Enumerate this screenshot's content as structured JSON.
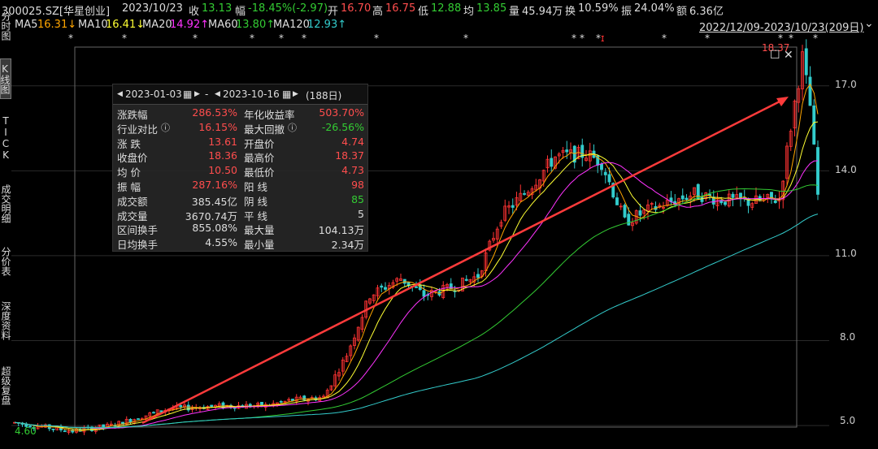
{
  "header": {
    "symbol": "300025.SZ[华星创业]",
    "date": "2023/10/23",
    "close_label": "收",
    "close": "13.13",
    "change_label": "幅",
    "change": "-18.45%(-2.97)",
    "open_label": "开",
    "open": "16.70",
    "high_label": "高",
    "high": "16.75",
    "low_label": "低",
    "low": "12.88",
    "avg_label": "均",
    "avg": "13.85",
    "vol_label": "量",
    "vol": "45.94万",
    "turnover_label": "换",
    "turnover": "10.59%",
    "amplitude_label": "振",
    "amplitude": "24.04%",
    "amount_label": "额",
    "amount": "6.36亿"
  },
  "ma": {
    "ma5_label": "MA5",
    "ma5": "16.31↓",
    "ma10_label": "MA10",
    "ma10": "16.41↓",
    "ma20_label": "MA20",
    "ma20": "14.92↑",
    "ma60_label": "MA60",
    "ma60": "13.80↑",
    "ma120_label": "MA120",
    "ma120": "12.93↑",
    "range": "2022/12/09-2023/10/23(209日)",
    "colors": {
      "ma5": "#ffa500",
      "ma10": "#ffff33",
      "ma20": "#ff33ff",
      "ma60": "#33cc33",
      "ma120": "#33cccc"
    }
  },
  "sidebar": {
    "tab1": "分时图",
    "tab2": "K线图",
    "tab3": "TICK",
    "tab4": "成交明细",
    "tab5": "分价表",
    "tab6": "深度资料",
    "tab7": "超级复盘"
  },
  "panel": {
    "start_date": "2023-01-03",
    "dash": "-",
    "end_date": "2023-10-16",
    "days": "(188日)",
    "rows": [
      {
        "l1": "涨跌幅",
        "v1": "286.53%",
        "l2": "年化收益率",
        "v2": "503.70%"
      },
      {
        "l1": "行业对比",
        "v1": "16.15%",
        "l2": "最大回撤",
        "v2": "-26.56%"
      },
      {
        "l1": "涨 跌",
        "v1": "13.61",
        "l2": "开盘价",
        "v2": "4.74"
      },
      {
        "l1": "收盘价",
        "v1": "18.36",
        "l2": "最高价",
        "v2": "18.37"
      },
      {
        "l1": "均 价",
        "v1": "10.50",
        "l2": "最低价",
        "v2": "4.73"
      },
      {
        "l1": "振 幅",
        "v1": "287.16%",
        "l2": "阳 线",
        "v2": "98"
      },
      {
        "l1": "成交额",
        "v1": "385.45亿",
        "l2": "阴 线",
        "v2": "85"
      },
      {
        "l1": "成交量",
        "v1": "3670.74万",
        "l2": "平 线",
        "v2": "5"
      },
      {
        "l1": "区间换手",
        "v1": "855.08%",
        "l2": "最大量",
        "v2": "104.13万"
      },
      {
        "l1": "日均换手",
        "v1": "4.55%",
        "l2": "最小量",
        "v2": "2.34万"
      }
    ]
  },
  "chart_data": {
    "type": "candlestick",
    "ylim": [
      4.4,
      18.6
    ],
    "yticks": [
      "17.0",
      "14.0",
      "11.0",
      "8.0",
      "5.0"
    ],
    "ytick_values": [
      17.0,
      14.0,
      11.0,
      8.0,
      5.0
    ],
    "peak_label": "18.37",
    "min_label": "4.60",
    "up_color": "#ff3333",
    "down_color": "#33cccc"
  }
}
